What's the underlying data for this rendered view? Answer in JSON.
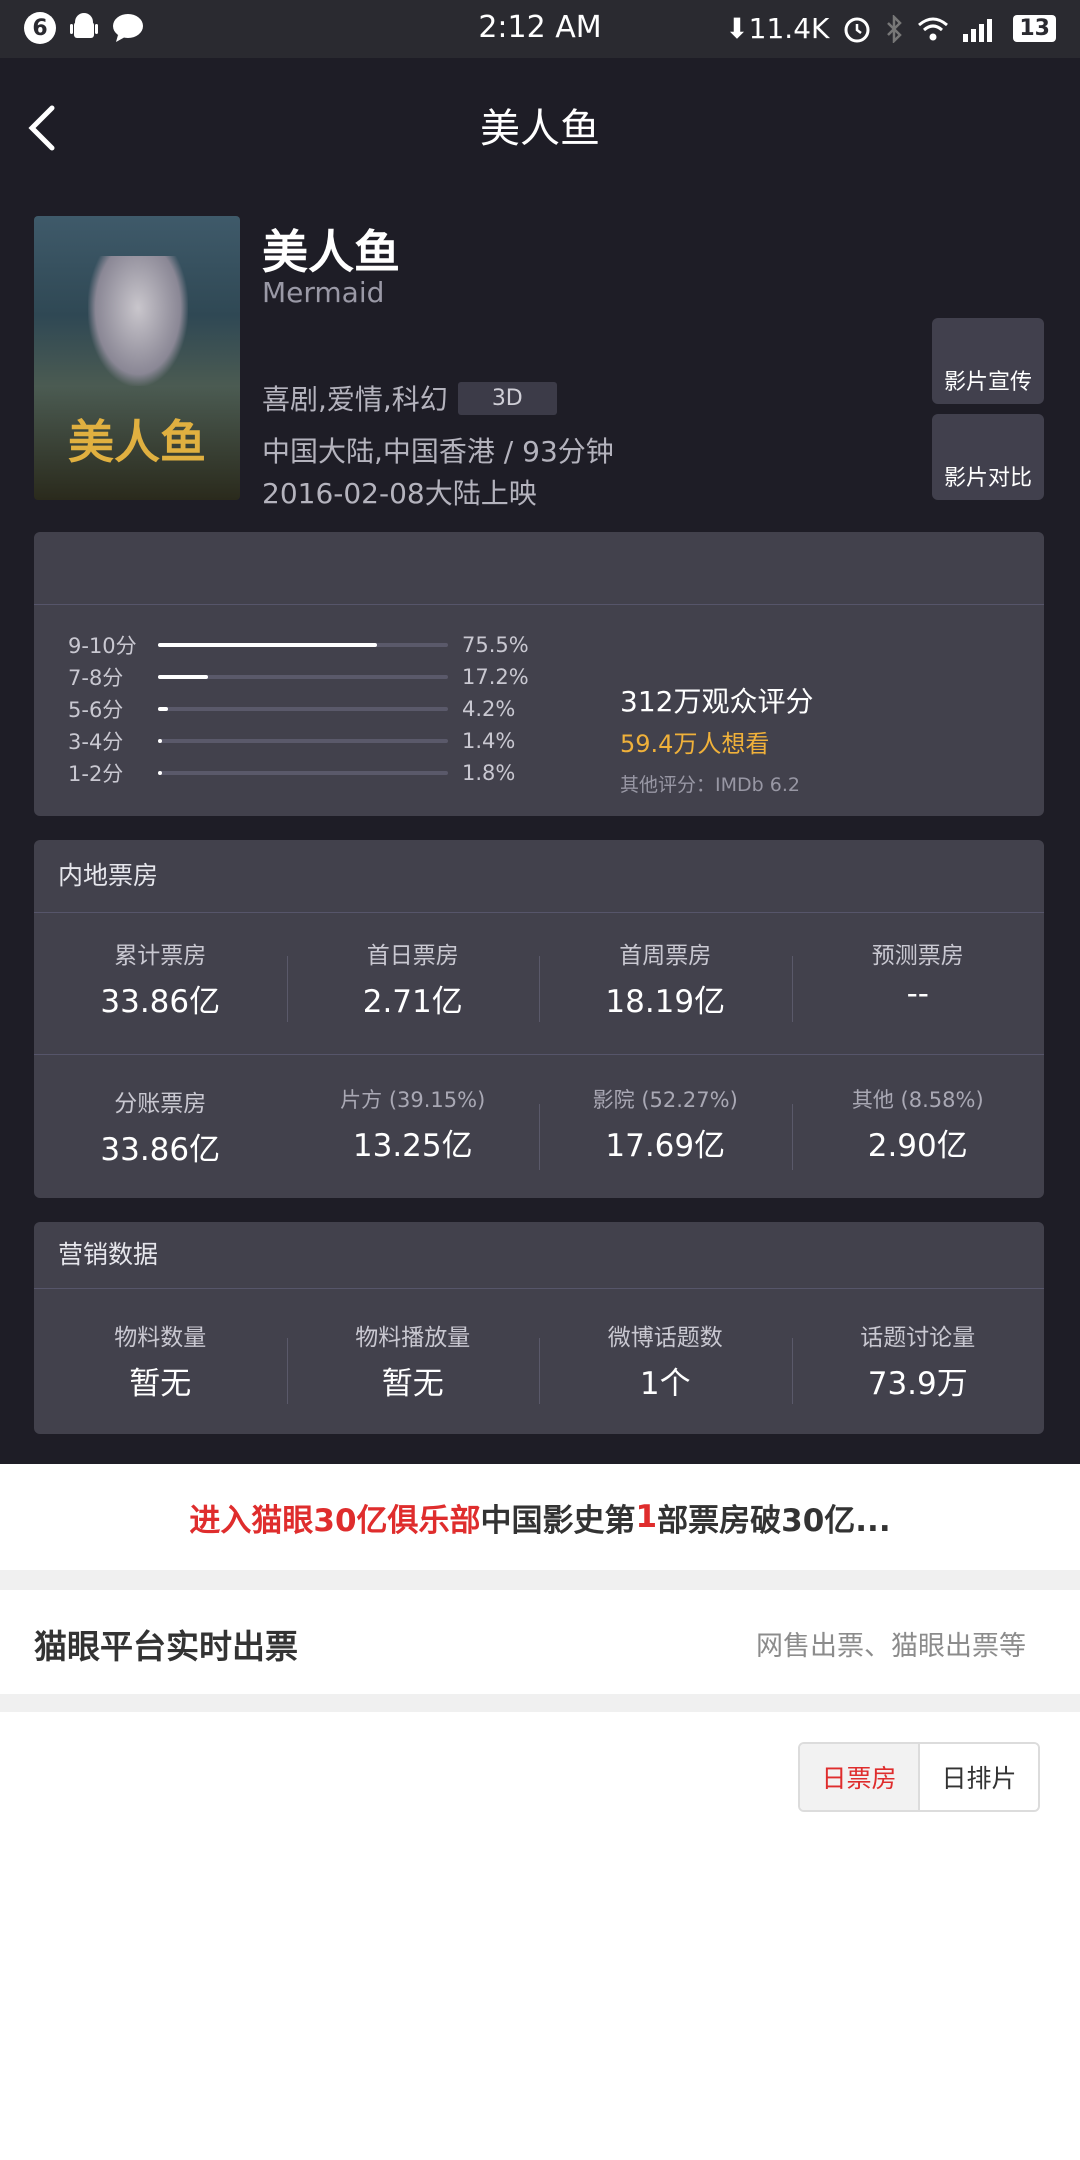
{
  "status_bar": {
    "notif_badge": "6",
    "time": "2:12 AM",
    "speed": "⬇11.4K",
    "battery": "13",
    "icons": [
      "android-icon",
      "message-icon",
      "alarm-icon",
      "bluetooth-icon",
      "wifi-icon",
      "signal-icon"
    ]
  },
  "nav": {
    "title": "美人鱼",
    "back_icon": "back-arrow-icon"
  },
  "movie": {
    "poster_text": "美人鱼",
    "title": "美人鱼",
    "title_en": "Mermaid",
    "genres": "喜剧,爱情,科幻",
    "format_tag": "3D",
    "region_duration": "中国大陆,中国香港 / 93分钟",
    "release": "2016-02-08大陆上映"
  },
  "side_buttons": {
    "promo": "影片宣传",
    "compare": "影片对比"
  },
  "ratings": {
    "rows": [
      {
        "label": "9-10分",
        "pct": "75.5%",
        "value": 75.5
      },
      {
        "label": "7-8分",
        "pct": "17.2%",
        "value": 17.2
      },
      {
        "label": "5-6分",
        "pct": "4.2%",
        "value": 4.2
      },
      {
        "label": "3-4分",
        "pct": "1.4%",
        "value": 1.4
      },
      {
        "label": "1-2分",
        "pct": "1.8%",
        "value": 1.8
      }
    ],
    "audience": "312万观众评分",
    "want": "59.4万人想看",
    "other": "其他评分：IMDb 6.2"
  },
  "box_office": {
    "title": "内地票房",
    "row1": [
      {
        "label": "累计票房",
        "value": "33.86亿"
      },
      {
        "label": "首日票房",
        "value": "2.71亿"
      },
      {
        "label": "首周票房",
        "value": "18.19亿"
      },
      {
        "label": "预测票房",
        "value": "--"
      }
    ],
    "row2": [
      {
        "label": "分账票房",
        "value": "33.86亿"
      },
      {
        "label": "片方 (39.15%)",
        "value": "13.25亿"
      },
      {
        "label": "影院 (52.27%)",
        "value": "17.69亿"
      },
      {
        "label": "其他 (8.58%)",
        "value": "2.90亿"
      }
    ]
  },
  "marketing": {
    "title": "营销数据",
    "items": [
      {
        "label": "物料数量",
        "value": "暂无"
      },
      {
        "label": "物料播放量",
        "value": "暂无"
      },
      {
        "label": "微博话题数",
        "value": "1个"
      },
      {
        "label": "话题讨论量",
        "value": "73.9万"
      }
    ]
  },
  "club": {
    "red_part": "进入猫眼30亿俱乐部",
    "mid_part": " 中国影史第 ",
    "num": "1",
    "tail": " 部票房破30亿..."
  },
  "realtime": {
    "title": "猫眼平台实时出票",
    "subtitle": "网售出票、猫眼出票等"
  },
  "toggle": {
    "active": "日票房",
    "inactive": "日排片"
  }
}
